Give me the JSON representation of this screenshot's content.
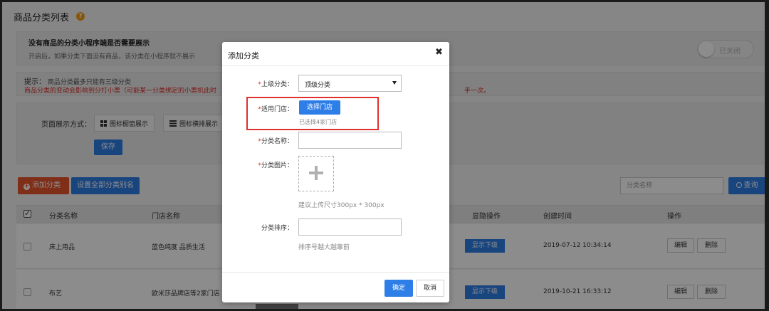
{
  "page": {
    "title": "商品分类列表",
    "help_icon": "help-icon"
  },
  "notice": {
    "title": "没有商品的分类小程序端是否需要展示",
    "desc": "开启后，如果分类下面没有商品，该分类在小程序就不展示",
    "toggle_label": "已关闭"
  },
  "tips": {
    "label": "提示：",
    "line1": "商品分类最多只能有三级分类",
    "line2": "商品分类的变动会影响到分打小票（可能某一分类绑定的小票机此时",
    "line2_end": "手一次。"
  },
  "display": {
    "label": "页面展示方式：",
    "mode_grid": "图标橱窗展示",
    "mode_list": "图标横排展示",
    "save": "保存"
  },
  "toolbar": {
    "add": "添加分类",
    "set_all_alias": "设置全部分类别名",
    "search_placeholder": "分类名称",
    "search": "查询"
  },
  "table": {
    "headers": {
      "name": "分类名称",
      "store": "门店名称",
      "visibility": "显隐操作",
      "created": "创建时间",
      "actions": "操作"
    },
    "rows": [
      {
        "name": "床上用品",
        "store": "蓝色纯度 品质生活",
        "visibility": "显示下级",
        "created": "2019-07-12 10:34:14",
        "edit": "编辑",
        "delete": "删除"
      },
      {
        "name": "布艺",
        "store": "欧米莎品牌店等2家门店",
        "visibility": "显示下级",
        "created": "2019-10-21 16:33:12",
        "edit": "编辑",
        "delete": "删除"
      }
    ]
  },
  "modal": {
    "title": "添加分类",
    "close": "✖",
    "parent_label": "上级分类：",
    "parent_value": "顶级分类",
    "store_label": "适用门店：",
    "store_button": "选择门店",
    "store_note": "已选择4家门店",
    "name_label": "分类名称：",
    "image_label": "分类图片：",
    "image_hint": "建议上传尺寸300px * 300px",
    "sort_label": "分类排序：",
    "sort_hint": "排序号越大越靠前",
    "ok": "确定",
    "cancel": "取消",
    "required_mark": "*"
  },
  "colors": {
    "primary": "#2e7ee8",
    "danger": "#e8542b",
    "warning_text": "#d9302c",
    "highlight_border": "#e0302e"
  }
}
